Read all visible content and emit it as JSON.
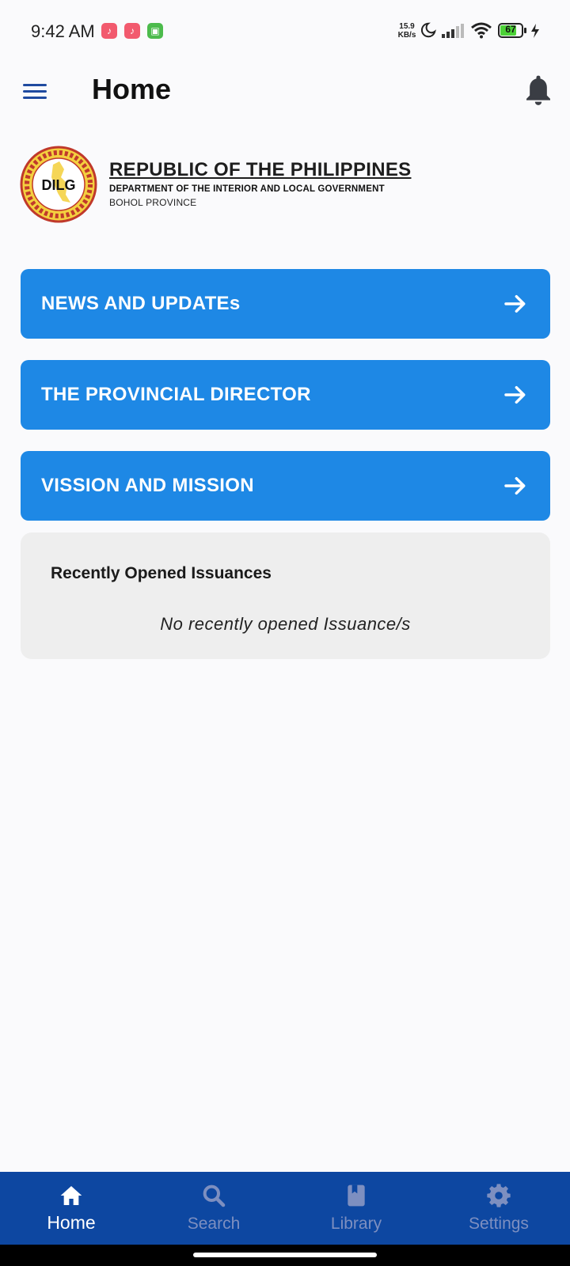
{
  "status_bar": {
    "time": "9:42 AM",
    "net_speed_value": "15.9",
    "net_speed_unit": "KB/s",
    "battery_level": "67",
    "notification_icons": [
      "tiktok-icon",
      "tiktok-icon",
      "messaging-app-icon"
    ]
  },
  "app_bar": {
    "title": "Home",
    "menu_icon": "hamburger-menu-icon",
    "notification_icon": "bell-icon"
  },
  "header": {
    "logo_text": "DILG",
    "title": "REPUBLIC OF THE PHILIPPINES",
    "department": "DEPARTMENT OF THE INTERIOR AND LOCAL GOVERNMENT",
    "province": "BOHOL PROVINCE"
  },
  "nav_cards": [
    {
      "label": "NEWS AND UPDATEs",
      "icon": "arrow-right-icon"
    },
    {
      "label": "THE PROVINCIAL DIRECTOR",
      "icon": "arrow-right-icon"
    },
    {
      "label": "VISSION AND MISSION",
      "icon": "arrow-right-icon"
    }
  ],
  "recent": {
    "title": "Recently Opened Issuances",
    "empty_message": "No recently opened Issuance/s"
  },
  "bottom_nav": {
    "items": [
      {
        "label": "Home",
        "icon": "home-icon",
        "active": true
      },
      {
        "label": "Search",
        "icon": "search-icon",
        "active": false
      },
      {
        "label": "Library",
        "icon": "book-icon",
        "active": false
      },
      {
        "label": "Settings",
        "icon": "gear-icon",
        "active": false
      }
    ]
  },
  "colors": {
    "accent": "#1e88e5",
    "nav_bar": "#0d47a1",
    "menu_icon": "#1f4aa0",
    "panel": "#eeeeee",
    "inactive_nav": "#7d8fc0"
  }
}
